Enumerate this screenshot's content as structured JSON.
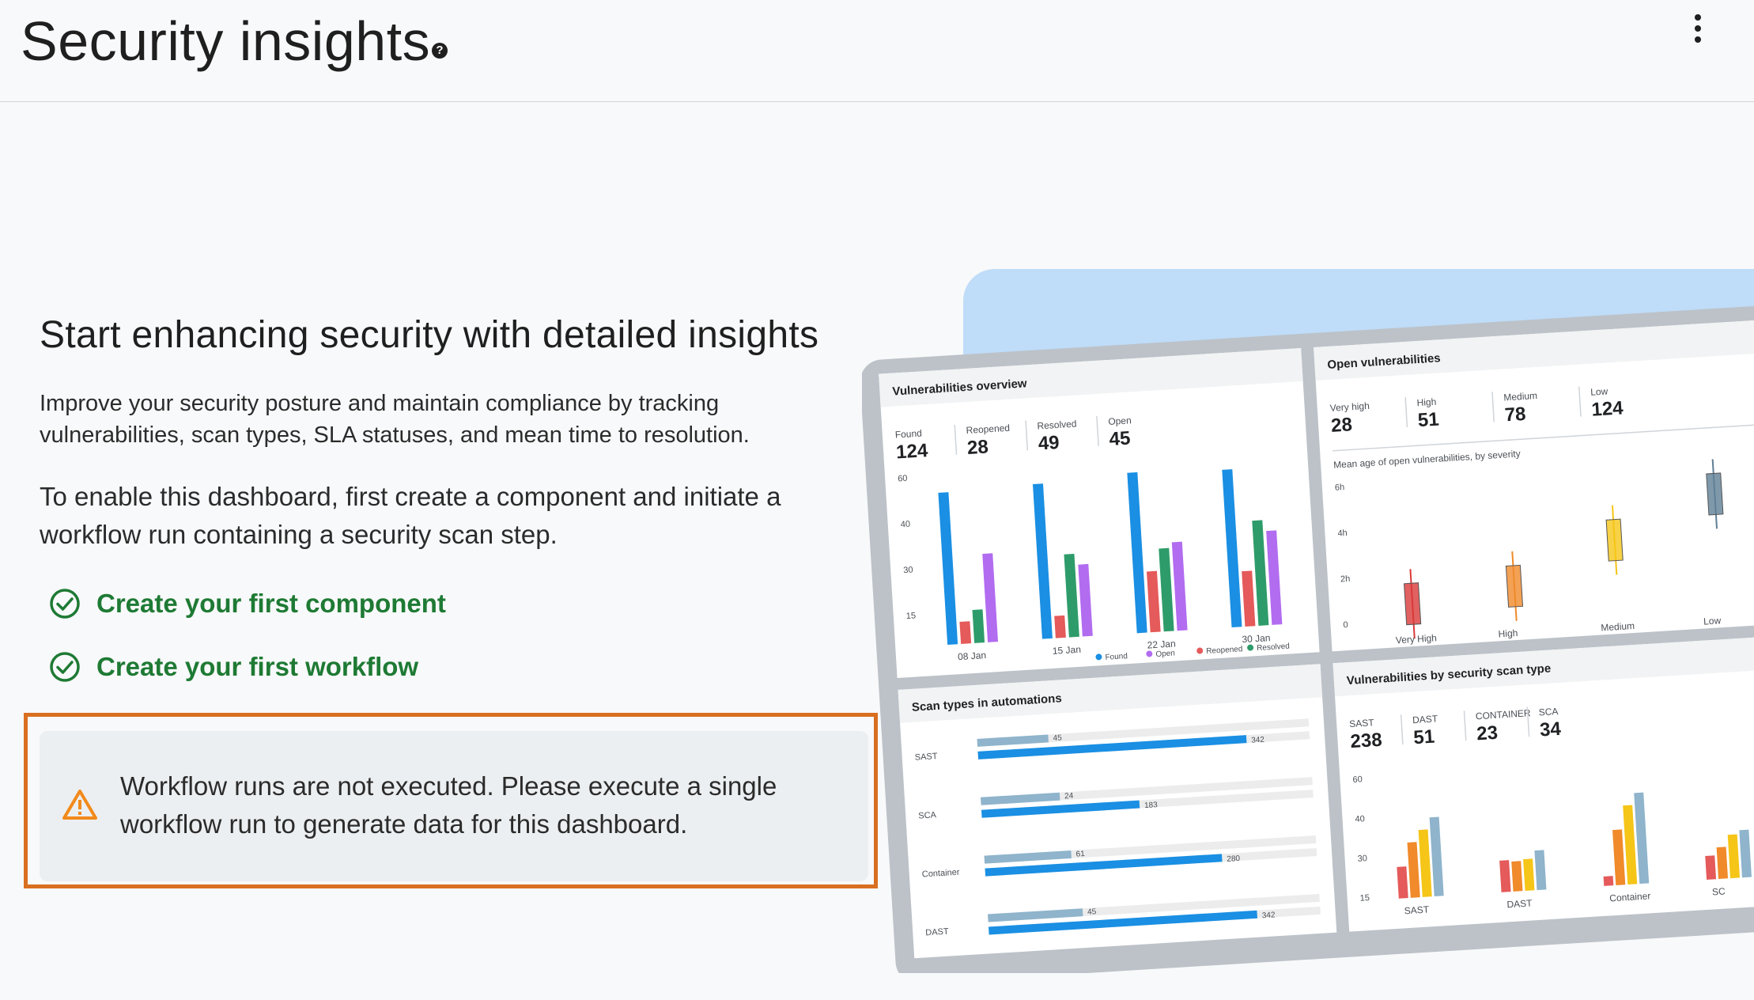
{
  "header": {
    "title": "Security insights",
    "help_icon": "help-icon",
    "menu_icon": "more-vert-icon"
  },
  "main": {
    "heading": "Start enhancing security with detailed insights",
    "description": "Improve your security posture and maintain compliance by tracking vulnerabilities, scan types, SLA statuses, and mean time to resolution.",
    "enable_text": "To enable this dashboard, first create a component and initiate a workflow run containing a security scan step.",
    "links": [
      {
        "label": "Create your first component",
        "icon": "check-circle-icon"
      },
      {
        "label": "Create your first workflow",
        "icon": "check-circle-icon"
      }
    ],
    "alert": {
      "icon": "warning-icon",
      "message": "Workflow runs are not executed. Please execute a single workflow run to generate data for this dashboard."
    }
  },
  "colors": {
    "link_green": "#1e7a34",
    "alert_border": "#d96f20",
    "warning": "#f28a1b",
    "found_blue": "#1a8fe3",
    "open_purple": "#b26cf0",
    "reopened_red": "#e55a5a",
    "resolved_green": "#2e9c6a"
  },
  "illustration": {
    "vuln_overview": {
      "title": "Vulnerabilities overview",
      "stats": [
        {
          "label": "Found",
          "value": "124"
        },
        {
          "label": "Reopened",
          "value": "28"
        },
        {
          "label": "Resolved",
          "value": "49"
        },
        {
          "label": "Open",
          "value": "45"
        }
      ],
      "chart_data": {
        "type": "bar",
        "categories": [
          "08 Jan",
          "15 Jan",
          "22 Jan",
          "30 Jan"
        ],
        "yticks": [
          "60",
          "40",
          "30",
          "15"
        ],
        "series": [
          {
            "name": "Found",
            "values": [
              55,
              56,
              58,
              57
            ]
          },
          {
            "name": "Reopened",
            "values": [
              8,
              8,
              22,
              20
            ]
          },
          {
            "name": "Resolved",
            "values": [
              12,
              30,
              30,
              38
            ]
          },
          {
            "name": "Open",
            "values": [
              32,
              26,
              32,
              34
            ]
          }
        ],
        "legend": [
          "Found",
          "Open",
          "Reopened",
          "Resolved"
        ]
      }
    },
    "open_vulns": {
      "title": "Open vulnerabilities",
      "stats": [
        {
          "label": "Very high",
          "value": "28"
        },
        {
          "label": "High",
          "value": "51"
        },
        {
          "label": "Medium",
          "value": "78"
        },
        {
          "label": "Low",
          "value": "124"
        }
      ],
      "subtitle": "Mean age of open vulnerabilities, by severity",
      "yticks": [
        "6h",
        "4h",
        "2h",
        "0"
      ],
      "categories": [
        "Very High",
        "High",
        "Medium",
        "Low"
      ]
    },
    "scan_types": {
      "title": "Scan types in automations",
      "rows": [
        {
          "label": "SAST",
          "a": "45",
          "b": "342"
        },
        {
          "label": "SCA",
          "a": "24",
          "b": "183"
        },
        {
          "label": "Container",
          "a": "61",
          "b": "280"
        },
        {
          "label": "DAST",
          "a": "45",
          "b": "342"
        }
      ]
    },
    "scan_vulns": {
      "title": "Vulnerabilities by security scan type",
      "stats": [
        {
          "label": "SAST",
          "value": "238"
        },
        {
          "label": "DAST",
          "value": "51"
        },
        {
          "label": "CONTAINER",
          "value": "23"
        },
        {
          "label": "SCA",
          "value": "34"
        }
      ],
      "yticks": [
        "60",
        "40",
        "30",
        "15"
      ],
      "categories": [
        "SAST",
        "DAST",
        "Container",
        "SC"
      ]
    }
  }
}
